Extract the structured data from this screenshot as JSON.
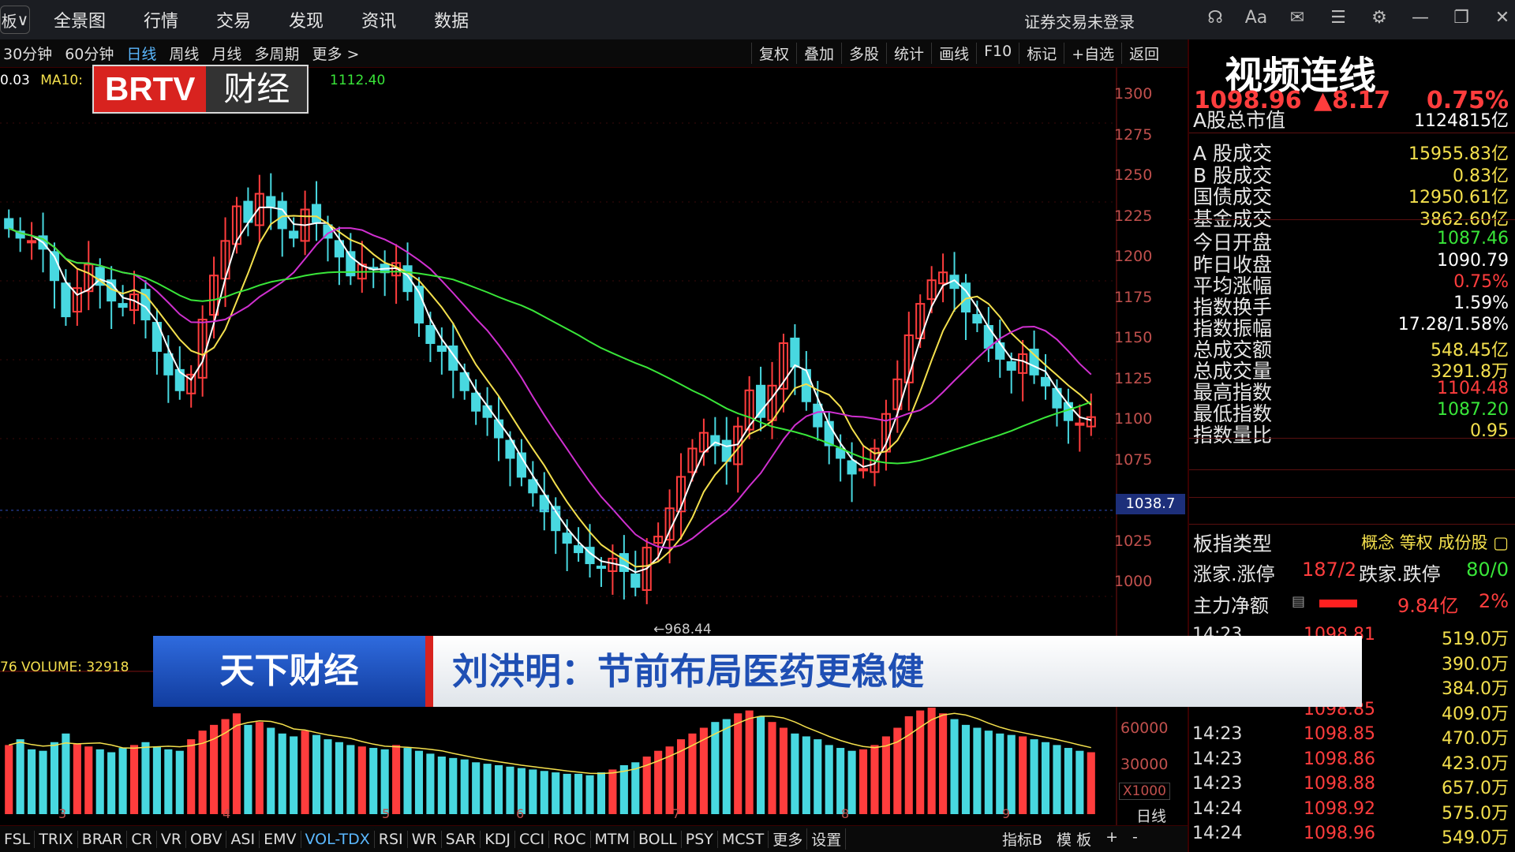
{
  "topbar": {
    "dropdown": "板",
    "menu": [
      "全景图",
      "行情",
      "交易",
      "发现",
      "资讯",
      "数据"
    ],
    "login_status": "证券交易未登录"
  },
  "toolbar": {
    "periods": [
      "30分钟",
      "60分钟",
      "日线",
      "周线",
      "月线",
      "多周期",
      "更多 >"
    ],
    "active_period": "日线",
    "tools": [
      "复权",
      "叠加",
      "多股",
      "统计",
      "画线",
      "F10",
      "标记",
      "+自选",
      "返回"
    ]
  },
  "logo": {
    "brand": "BRTV",
    "channel": "财经"
  },
  "ma_legend": {
    "ma5_value": "0.03",
    "ma10_label": "MA10:",
    "ma20_value": "1112.40"
  },
  "chart_data": {
    "type": "candlestick",
    "yticks": [
      "1300",
      "1275",
      "1250",
      "1225",
      "1200",
      "1175",
      "1150",
      "1125",
      "1100",
      "1075",
      "1050",
      "1025",
      "1000"
    ],
    "ylim": [
      994,
      1304
    ],
    "current_price_label": "1038.7",
    "low_label": "←968.44",
    "date_labels": [
      "3",
      "4",
      "5",
      "6",
      "7",
      "8",
      "9"
    ],
    "volume_legend": "76 VOLUME: 32918",
    "volume_ticks": [
      "60000",
      "30000"
    ],
    "volume_multiplier": "X1000",
    "period_label": "日线",
    "closes": [
      1218,
      1212,
      1210,
      1205,
      1185,
      1162,
      1180,
      1195,
      1182,
      1172,
      1168,
      1176,
      1160,
      1140,
      1125,
      1115,
      1125,
      1160,
      1188,
      1210,
      1232,
      1222,
      1240,
      1232,
      1218,
      1212,
      1230,
      1222,
      1212,
      1200,
      1188,
      1195,
      1192,
      1190,
      1196,
      1178,
      1158,
      1145,
      1140,
      1128,
      1115,
      1102,
      1098,
      1085,
      1072,
      1060,
      1050,
      1038,
      1026,
      1018,
      1012,
      1005,
      1002,
      1008,
      1000,
      990,
      1015,
      1022,
      1040,
      1060,
      1078,
      1088,
      1080,
      1070,
      1092,
      1115,
      1098,
      1118,
      1145,
      1130,
      1108,
      1092,
      1080,
      1072,
      1062,
      1065,
      1078,
      1100,
      1122,
      1150,
      1170,
      1185,
      1190,
      1180,
      1165,
      1158,
      1142,
      1135,
      1128,
      1138,
      1125,
      1118,
      1104,
      1096,
      1094,
      1098
    ],
    "volumes": [
      48,
      52,
      45,
      44,
      50,
      56,
      49,
      47,
      45,
      43,
      46,
      48,
      50,
      47,
      45,
      44,
      52,
      58,
      62,
      66,
      70,
      62,
      64,
      60,
      56,
      54,
      58,
      55,
      52,
      50,
      48,
      47,
      46,
      45,
      48,
      46,
      44,
      42,
      40,
      39,
      38,
      36,
      35,
      34,
      33,
      32,
      31,
      30,
      29,
      28,
      28,
      27,
      29,
      31,
      34,
      36,
      40,
      44,
      47,
      52,
      56,
      60,
      64,
      66,
      70,
      72,
      68,
      64,
      60,
      56,
      54,
      52,
      48,
      46,
      44,
      45,
      48,
      54,
      60,
      68,
      72,
      74,
      70,
      66,
      62,
      60,
      58,
      56,
      55,
      54,
      52,
      50,
      48,
      46,
      44,
      43
    ]
  },
  "indicators": [
    "FSL",
    "TRIX",
    "BRAR",
    "CR",
    "VR",
    "OBV",
    "ASI",
    "EMV",
    "VOL-TDX",
    "RSI",
    "WR",
    "SAR",
    "KDJ",
    "CCI",
    "ROC",
    "MTM",
    "BOLL",
    "PSY",
    "MCST",
    "更多",
    "设置"
  ],
  "active_indicator": "VOL-TDX",
  "indicator_right": [
    "指标B",
    "模 板",
    "+",
    "-"
  ],
  "panel": {
    "title": "视频连线",
    "price": "1098.96",
    "change": "▲8.17",
    "change_pct": "0.75%",
    "stats": [
      {
        "label": "A股总市值",
        "value": "1124815亿",
        "color": "white"
      },
      {
        "label": "A 股成交",
        "value": "15955.83亿",
        "color": "yellow"
      },
      {
        "label": "B 股成交",
        "value": "0.83亿",
        "color": "yellow"
      },
      {
        "label": "国债成交",
        "value": "12950.61亿",
        "color": "yellow"
      },
      {
        "label": "基金成交",
        "value": "3862.60亿",
        "color": "yellow"
      },
      {
        "label": "今日开盘",
        "value": "1087.46",
        "color": "green"
      },
      {
        "label": "昨日收盘",
        "value": "1090.79",
        "color": "white"
      },
      {
        "label": "平均涨幅",
        "value": "0.75%",
        "color": "red"
      },
      {
        "label": "指数换手",
        "value": "1.59%",
        "color": "white"
      },
      {
        "label": "指数振幅",
        "value": "17.28/1.58%",
        "color": "white"
      },
      {
        "label": "总成交额",
        "value": "548.45亿",
        "color": "yellow"
      },
      {
        "label": "总成交量",
        "value": "3291.8万",
        "color": "yellow"
      },
      {
        "label": "最高指数",
        "value": "1104.48",
        "color": "red"
      },
      {
        "label": "最低指数",
        "value": "1087.20",
        "color": "green"
      },
      {
        "label": "指数量比",
        "value": "0.95",
        "color": "yellow"
      }
    ],
    "type_label": "板指类型",
    "type_tags": "概念 等权 成份股",
    "rise_label": "涨家.涨停",
    "rise_value": "187/2",
    "fall_label": "跌家.跌停",
    "fall_value": "80/0",
    "net_label": "主力净额",
    "net_value": "9.84亿",
    "net_pct": "2%",
    "trades": [
      {
        "time": "14:23",
        "price": "1098.81",
        "qty": "519.0万"
      },
      {
        "time": "",
        "price": "",
        "qty": "390.0万"
      },
      {
        "time": "",
        "price": "",
        "qty": "384.0万"
      },
      {
        "time": "",
        "price": "1098.85",
        "qty": "409.0万"
      },
      {
        "time": "14:23",
        "price": "1098.85",
        "qty": "470.0万"
      },
      {
        "time": "14:23",
        "price": "1098.86",
        "qty": "423.0万"
      },
      {
        "time": "14:23",
        "price": "1098.88",
        "qty": "657.0万"
      },
      {
        "time": "14:24",
        "price": "1098.92",
        "qty": "575.0万"
      },
      {
        "time": "14:24",
        "price": "1098.96",
        "qty": "549.0万"
      }
    ]
  },
  "banner": {
    "program": "天下财经",
    "headline": "刘洪明：节前布局医药更稳健"
  },
  "colors": {
    "up": "#ff3d3d",
    "down": "#48d8e0",
    "ma5": "#ffffff",
    "ma10": "#f4e04d",
    "ma20": "#d030d0",
    "ma60": "#39e639"
  }
}
